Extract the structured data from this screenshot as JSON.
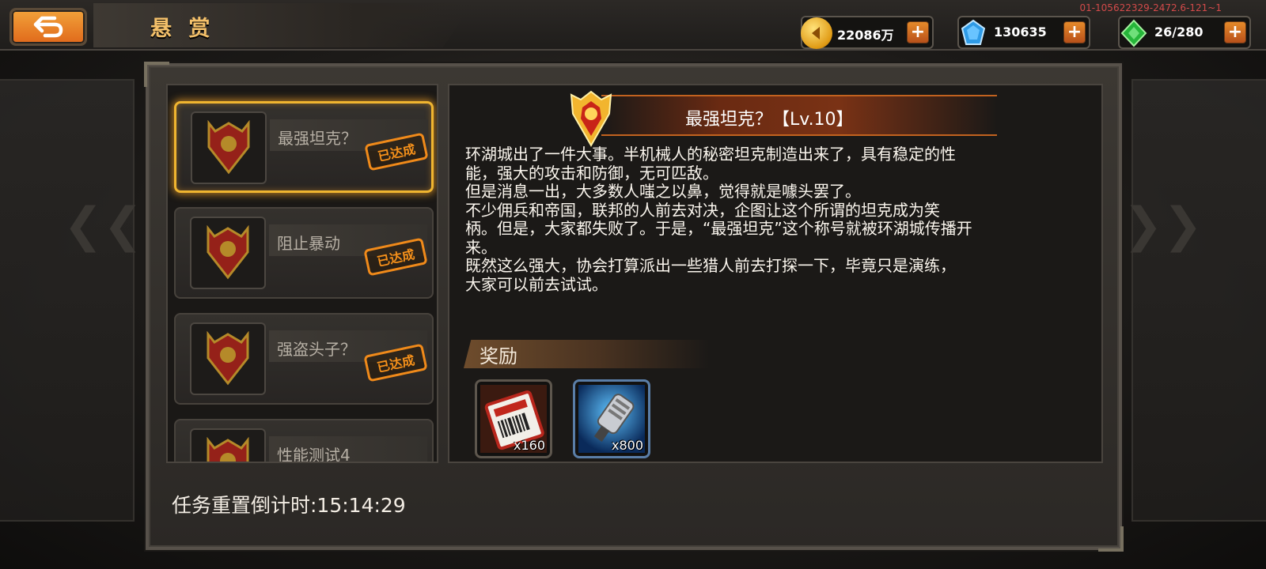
{
  "header": {
    "title": "悬 赏",
    "build_id": "01-105622329-2472.6-121~1",
    "colors": {
      "accent": "#f0a030",
      "title": "#f3c06a"
    }
  },
  "currencies": [
    {
      "icon": "gold-coin-icon",
      "value": "22086万"
    },
    {
      "icon": "blue-crystal-icon",
      "value": "130635"
    },
    {
      "icon": "green-energy-icon",
      "value": "26/280"
    }
  ],
  "missions": [
    {
      "name": "最强坦克？",
      "status": "已达成",
      "selected": true
    },
    {
      "name": "阻止暴动",
      "status": "已达成",
      "selected": false
    },
    {
      "name": "强盗头子？",
      "status": "已达成",
      "selected": false
    },
    {
      "name": "性能测试4",
      "status": "",
      "selected": false
    }
  ],
  "detail": {
    "title": "最强坦克？【Lv.10】",
    "description": [
      "环湖城出了一件大事。半机械人的秘密坦克制造出来了，具有稳定的性",
      "能，强大的攻击和防御，无可匹敌。",
      "但是消息一出，大多数人嗤之以鼻，觉得就是噱头罢了。",
      "不少佣兵和帝国，联邦的人前去对决，企图让这个所谓的坦克成为笑",
      "柄。但是，大家都失败了。于是，“最强坦克”这个称号就被环湖城传播开",
      "来。",
      "既然这么强大，协会打算派出一些猎人前去打探一下，毕竟只是演练，",
      "大家可以前去试试。"
    ],
    "reward_title": "奖励",
    "rewards": [
      {
        "icon": "ticket-icon",
        "quantity": "x160"
      },
      {
        "icon": "engine-part-icon",
        "quantity": "x800"
      }
    ]
  },
  "footer": {
    "reset_timer": "任务重置倒计时:15:14:29"
  }
}
